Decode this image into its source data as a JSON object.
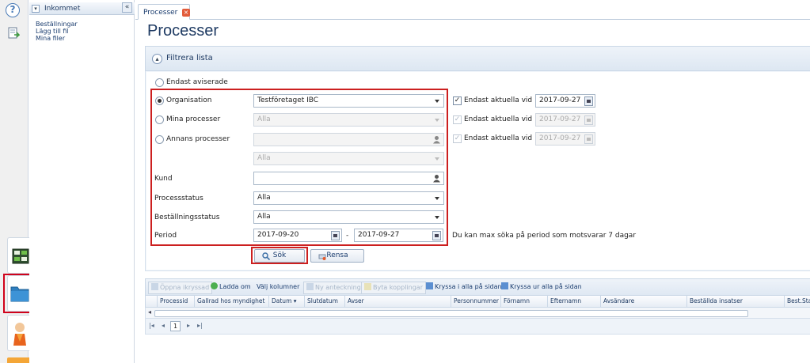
{
  "rail": {
    "help_label": "?",
    "icons": [
      "help-icon",
      "document-arrow-icon",
      "process-board-icon",
      "folder-icon",
      "person-icon"
    ]
  },
  "tree": {
    "title": "Inkommet",
    "links": [
      "Beställningar",
      "Lägg till fil",
      "Mina filer"
    ]
  },
  "tabs": [
    {
      "label": "Processer"
    }
  ],
  "page": {
    "title": "Processer"
  },
  "filter": {
    "header": "Filtrera lista",
    "options": {
      "endast_aviserade": "Endast aviserade",
      "organisation": "Organisation",
      "mina_processer": "Mina processer",
      "annans_processer": "Annans processer"
    },
    "selected_option": "organisation",
    "organisation_value": "Testföretaget IBC",
    "mina_value": "Alla",
    "annans_value": "",
    "annans_sub_value": "Alla",
    "kund_label": "Kund",
    "kund_value": "",
    "processstatus_label": "Processstatus",
    "processstatus_value": "Alla",
    "bestallningsstatus_label": "Beställningsstatus",
    "bestallningsstatus_value": "Alla",
    "period_label": "Period",
    "period_from": "2017-09-20",
    "period_sep": "-",
    "period_to": "2017-09-27",
    "period_note": "Du kan max söka på period som motsvarar 7 dagar",
    "aktuella": [
      {
        "label": "Endast aktuella vid",
        "date": "2017-09-27",
        "checked": true,
        "enabled": true
      },
      {
        "label": "Endast aktuella vid",
        "date": "2017-09-27",
        "checked": true,
        "enabled": false
      },
      {
        "label": "Endast aktuella vid",
        "date": "2017-09-27",
        "checked": true,
        "enabled": false
      }
    ],
    "search_button": "Sök",
    "clear_button": "Rensa"
  },
  "grid": {
    "toolbar": {
      "open_checked": "Öppna ikryssad",
      "load": "Ladda om",
      "choose_columns": "Välj kolumner",
      "new_note": "Ny anteckning",
      "change_link": "Byta kopplingar",
      "check_all": "Kryssa i alla på sidan",
      "uncheck_all": "Kryssa ur alla på sidan"
    },
    "columns": [
      "Processid",
      "Gallrad hos myndighet",
      "Datum",
      "Slutdatum",
      "Avser",
      "Personnummer",
      "Förnamn",
      "Efternamn",
      "Avsändare",
      "Beställda insatser",
      "Best.Sta"
    ],
    "sort_column": "Datum",
    "pager": {
      "page": "1"
    }
  },
  "colors": {
    "accent": "#1f3b63",
    "highlight": "#cc1f1f",
    "panel_bg": "#f2f6fb"
  }
}
